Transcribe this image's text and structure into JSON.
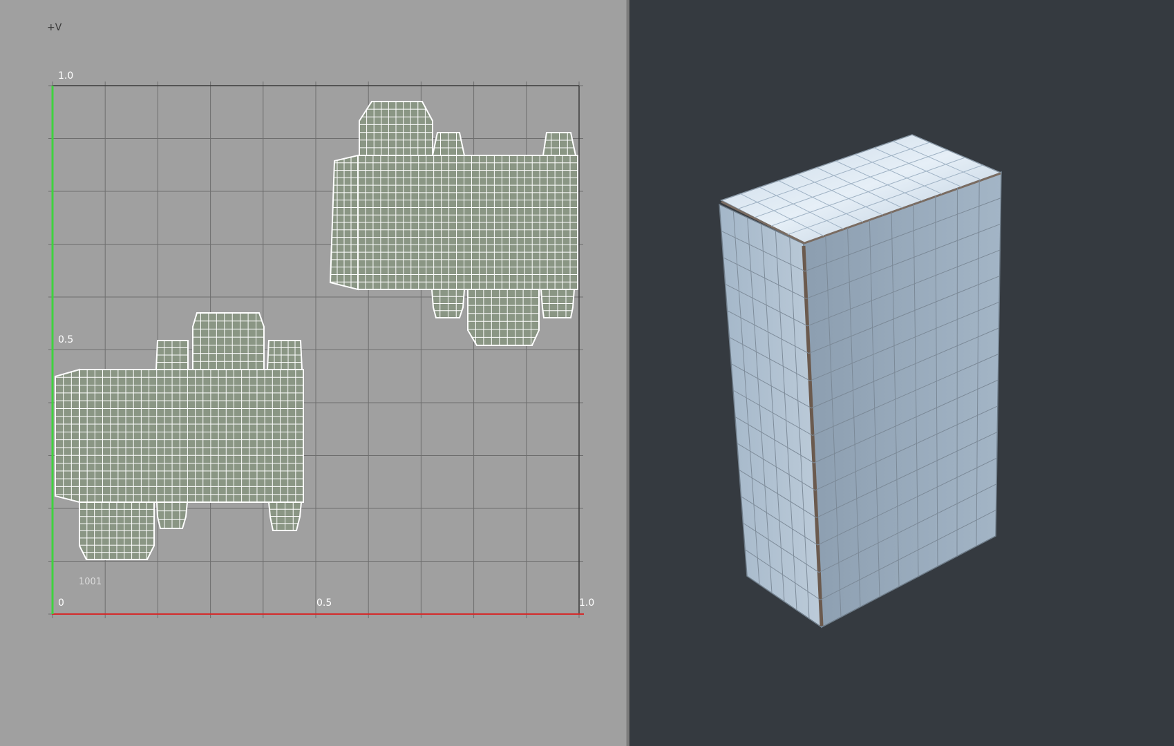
{
  "uv_editor": {
    "axis_v_label": "+V",
    "tick_u_0": "0",
    "tick_u_half": "0.5",
    "tick_u_1": "1.0",
    "tick_v_half": "0.5",
    "tick_v_1": "1.0",
    "udim_tile": "1001",
    "colors": {
      "background": "#a0a0a0",
      "grid": "#6e6e6e",
      "u_axis": "#d42a2a",
      "v_axis": "#3fd23f",
      "shell_fill": "#8a9684",
      "wire": "#ffffff"
    }
  },
  "viewport_3d": {
    "object": "box",
    "colors": {
      "background": "#353a40",
      "mesh": "#a9bccd",
      "wire": "#7f8d9b"
    }
  }
}
